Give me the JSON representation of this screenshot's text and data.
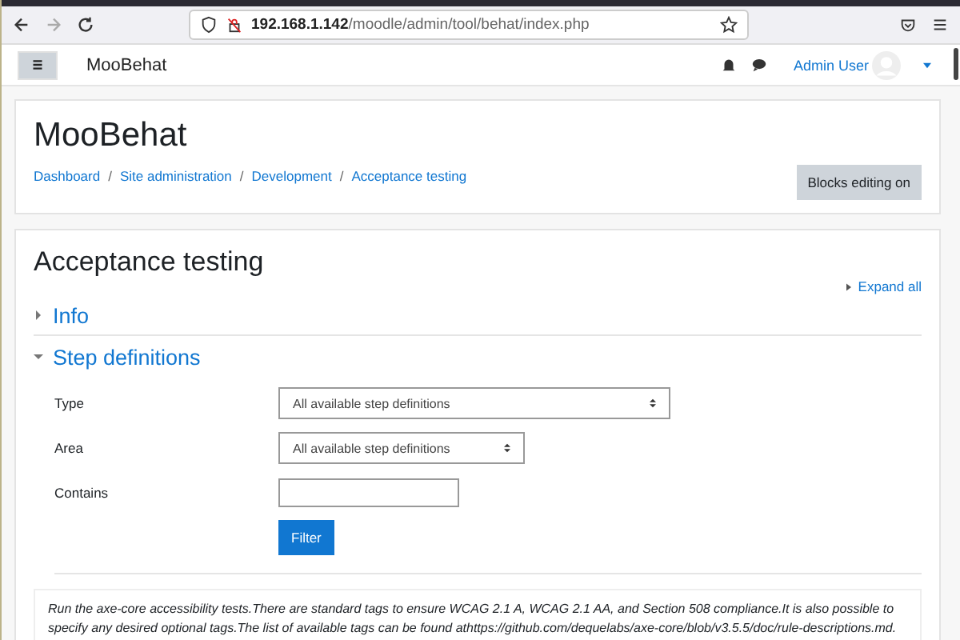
{
  "browser": {
    "url_host": "192.168.1.142",
    "url_path": "/moodle/admin/tool/behat/index.php"
  },
  "navbar": {
    "site_name": "MooBehat",
    "user_name": "Admin User"
  },
  "header": {
    "title": "MooBehat",
    "breadcrumbs": [
      "Dashboard",
      "Site administration",
      "Development",
      "Acceptance testing"
    ],
    "breadcrumb_separator": "/",
    "button": "Blocks editing on"
  },
  "main": {
    "title": "Acceptance testing",
    "expand_all": "Expand all",
    "sections": [
      {
        "title": "Info",
        "expanded": false
      },
      {
        "title": "Step definitions",
        "expanded": true
      }
    ],
    "form": {
      "fields": [
        {
          "kind": "select",
          "label": "Type",
          "value": "All available step definitions",
          "wide": true
        },
        {
          "kind": "select",
          "label": "Area",
          "value": "All available step definitions",
          "wide": false
        },
        {
          "kind": "text",
          "label": "Contains"
        }
      ],
      "button": "Filter"
    },
    "description": "Run the axe-core accessibility tests.There are standard tags to ensure WCAG 2.1 A, WCAG 2.1 AA, and Section 508 compliance.It is also possible to specify any desired optional tags.The list of available tags can be found athttps://github.com/dequelabs/axe-core/blob/v3.5.5/doc/rule-descriptions.md."
  }
}
